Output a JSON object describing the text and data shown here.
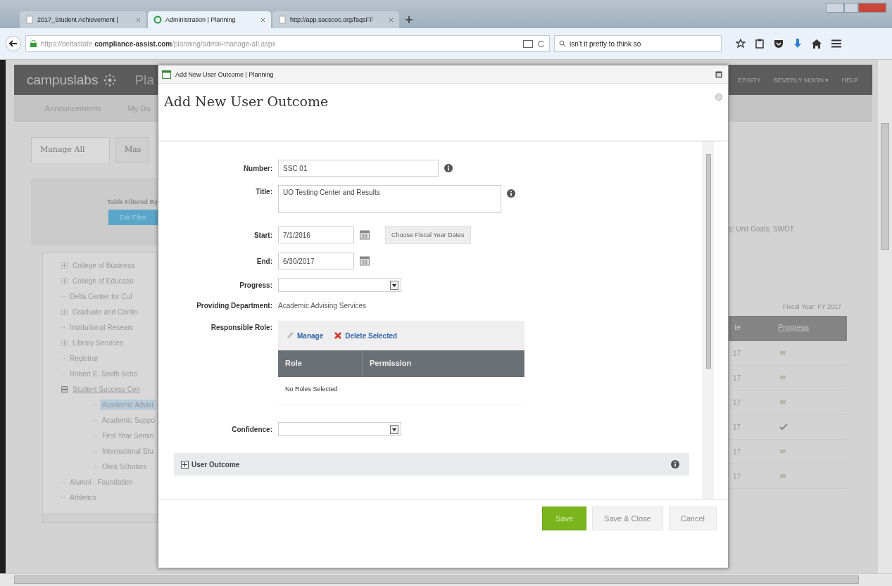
{
  "browser": {
    "tabs": [
      {
        "label": "2017_Student Achievement |",
        "selected": false
      },
      {
        "label": "Administration | Planning",
        "selected": true
      },
      {
        "label": "http://app.sacscoc.org/faqsFF",
        "selected": false
      }
    ],
    "address": "https://deltastate.**compliance-assist.com**/planning/admin-manage-all.aspx",
    "search": {
      "value": "isn't it pretty to think so"
    }
  },
  "page": {
    "logo": "campuslabs",
    "app_title": "Pla",
    "header_links": [
      "ERSITY",
      "BEVERLY MOON ▾",
      "HELP"
    ],
    "nav": [
      "Announcements",
      "My Da"
    ],
    "tabs": [
      {
        "label": "Manage All",
        "selected": true
      },
      {
        "label": "Mas",
        "selected": false
      }
    ],
    "filter_label": "Table Filtered By",
    "filter_button": "Edit Filter",
    "filter_summary": "s; Unit Goals; SWOT",
    "tree": [
      {
        "label": "College of Business",
        "expanded": false,
        "selected": false
      },
      {
        "label": "College of Educatio",
        "expanded": false,
        "selected": false
      },
      {
        "label": "Delta Center for Cul",
        "selected": false
      },
      {
        "label": "Graduate and Contin",
        "expanded": false,
        "selected": false
      },
      {
        "label": "Institutional Researc",
        "selected": false
      },
      {
        "label": "Library Services",
        "expanded": false,
        "selected": false
      },
      {
        "label": "Registrar",
        "selected": false
      },
      {
        "label": "Robert E. Smith Scho",
        "selected": false
      },
      {
        "label": "Student Success Cen",
        "expanded": true,
        "selected": false,
        "children": [
          {
            "label": "Academic Advisi",
            "selected": true
          },
          {
            "label": "Academic Suppo",
            "selected": false
          },
          {
            "label": "First Year Semin",
            "selected": false
          },
          {
            "label": "International Stu",
            "selected": false
          },
          {
            "label": "Okra Scholars",
            "selected": false
          }
        ]
      },
      {
        "label": "Alumni - Foundation",
        "selected": false
      },
      {
        "label": "Athletics",
        "selected": false
      }
    ],
    "fiscal_year": "Fiscal Year: FY 2017",
    "table": {
      "columns": [
        "te",
        "Progress"
      ],
      "rows": [
        {
          "date": "17",
          "kind": "flag"
        },
        {
          "date": "17",
          "kind": "flag"
        },
        {
          "date": "17",
          "kind": "flag"
        },
        {
          "date": "17",
          "kind": "check"
        },
        {
          "date": "17",
          "kind": "flag"
        },
        {
          "date": "17",
          "kind": "flag"
        }
      ]
    }
  },
  "dialog": {
    "window_title": "Add New User Outcome | Planning",
    "heading": "Add New User Outcome",
    "fields": [
      {
        "kind": "text",
        "label": "Number:",
        "value": "SSC 01",
        "info": true
      },
      {
        "kind": "textarea",
        "label": "Title:",
        "value": "UO Testing Center and Results",
        "info": true
      },
      {
        "kind": "date",
        "label": "Start:",
        "value": "7/1/2016",
        "button": "Choose Fiscal Year Dates"
      },
      {
        "kind": "date",
        "label": "End:",
        "value": "6/30/2017"
      },
      {
        "kind": "select",
        "label": "Progress:"
      },
      {
        "kind": "static",
        "label": "Providing Department:",
        "value": "Academic Advising Services"
      },
      {
        "kind": "roles",
        "label": "Responsible Role:",
        "actions": [
          {
            "kind": "manage",
            "label": "Manage"
          },
          {
            "kind": "delete",
            "label": "Delete Selected"
          }
        ],
        "columns": [
          "Role",
          "Permission"
        ],
        "empty": "No Roles Selected"
      },
      {
        "kind": "select",
        "label": "Confidence:"
      }
    ],
    "section": {
      "label": "User Outcome",
      "expanded": false
    },
    "buttons": [
      {
        "label": "Save",
        "primary": true
      },
      {
        "label": "Save & Close",
        "primary": false
      },
      {
        "label": "Cancel",
        "primary": false
      }
    ]
  }
}
